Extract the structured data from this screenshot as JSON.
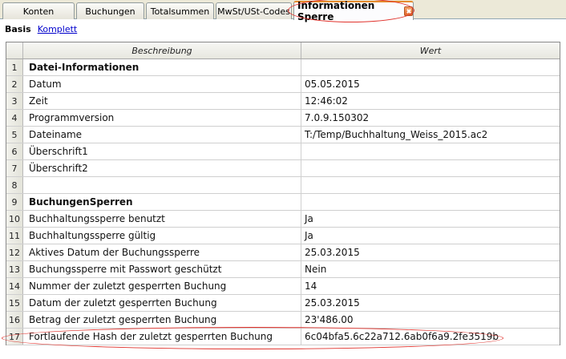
{
  "tabs": [
    {
      "label": "Konten",
      "active": false
    },
    {
      "label": "Buchungen",
      "active": false
    },
    {
      "label": "Totalsummen",
      "active": false
    },
    {
      "label": "MwSt/USt-Codes",
      "active": false
    },
    {
      "label": "Informationen Sperre",
      "active": true
    }
  ],
  "views": {
    "basis": "Basis",
    "komplett": "Komplett"
  },
  "table": {
    "columns": [
      "Beschreibung",
      "Wert"
    ],
    "rows": [
      {
        "n": "1",
        "desc": "Datei-Informationen",
        "value": ""
      },
      {
        "n": "2",
        "desc": "Datum",
        "value": "05.05.2015"
      },
      {
        "n": "3",
        "desc": "Zeit",
        "value": "12:46:02"
      },
      {
        "n": "4",
        "desc": "Programmversion",
        "value": "7.0.9.150302"
      },
      {
        "n": "5",
        "desc": "Dateiname",
        "value": "T:/Temp/Buchhaltung_Weiss_2015.ac2"
      },
      {
        "n": "6",
        "desc": "Überschrift1",
        "value": ""
      },
      {
        "n": "7",
        "desc": "Überschrift2",
        "value": ""
      },
      {
        "n": "8",
        "desc": "",
        "value": ""
      },
      {
        "n": "9",
        "desc": "BuchungenSperren",
        "value": ""
      },
      {
        "n": "10",
        "desc": "Buchhaltungssperre benutzt",
        "value": "Ja"
      },
      {
        "n": "11",
        "desc": "Buchhaltungssperre gültig",
        "value": "Ja"
      },
      {
        "n": "12",
        "desc": "Aktives Datum der Buchungssperre",
        "value": "25.03.2015"
      },
      {
        "n": "13",
        "desc": "Buchungssperre mit Passwort geschützt",
        "value": "Nein"
      },
      {
        "n": "14",
        "desc": "Nummer der zuletzt gesperrten Buchung",
        "value": "14"
      },
      {
        "n": "15",
        "desc": "Datum der zuletzt gesperrten Buchung",
        "value": "25.03.2015"
      },
      {
        "n": "16",
        "desc": "Betrag der zuletzt gesperrten Buchung",
        "value": "23'486.00"
      },
      {
        "n": "17",
        "desc": "Fortlaufende Hash der zuletzt  gesperrten Buchung",
        "value": "6c04bfa5.6c22a712.6ab0f6a9.2fe3519b"
      }
    ]
  },
  "colors": {
    "highlight": "#e0322c",
    "link": "#0000cc"
  }
}
